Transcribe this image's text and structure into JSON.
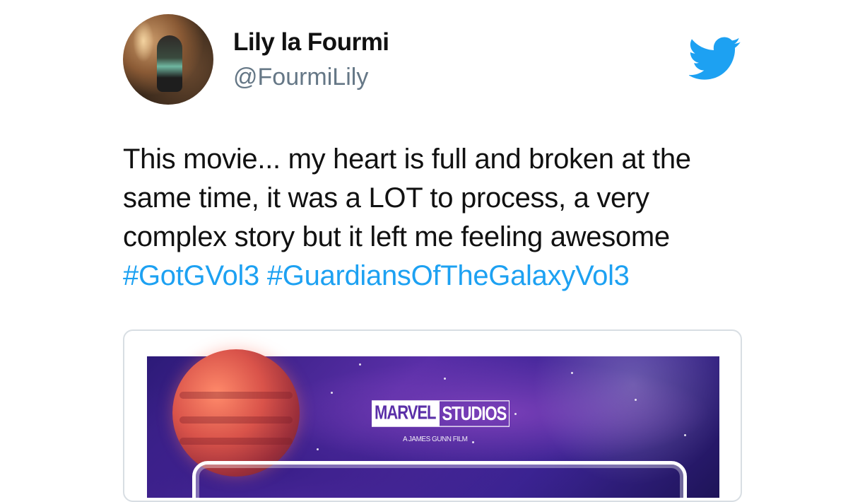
{
  "author": {
    "display_name": "Lily la Fourmi",
    "handle": "@FourmiLily"
  },
  "tweet": {
    "lines": [
      "This movie... my heart is full and broken at the",
      "same time, it was a LOT to process, a very",
      "complex story but it left me feeling awesome"
    ],
    "hashtags": [
      "#GotGVol3",
      "#GuardiansOfTheGalaxyVol3"
    ]
  },
  "media": {
    "studio_logo_left": "MARVEL",
    "studio_logo_right": "STUDIOS",
    "director_credit": "A JAMES GUNN FILM"
  },
  "icons": {
    "brand": "twitter-bird-icon"
  },
  "colors": {
    "text": "#111111",
    "handle": "#657786",
    "hashtag": "#1da1f2",
    "twitter_blue": "#1da1f2",
    "card_border": "#d8dee3"
  }
}
